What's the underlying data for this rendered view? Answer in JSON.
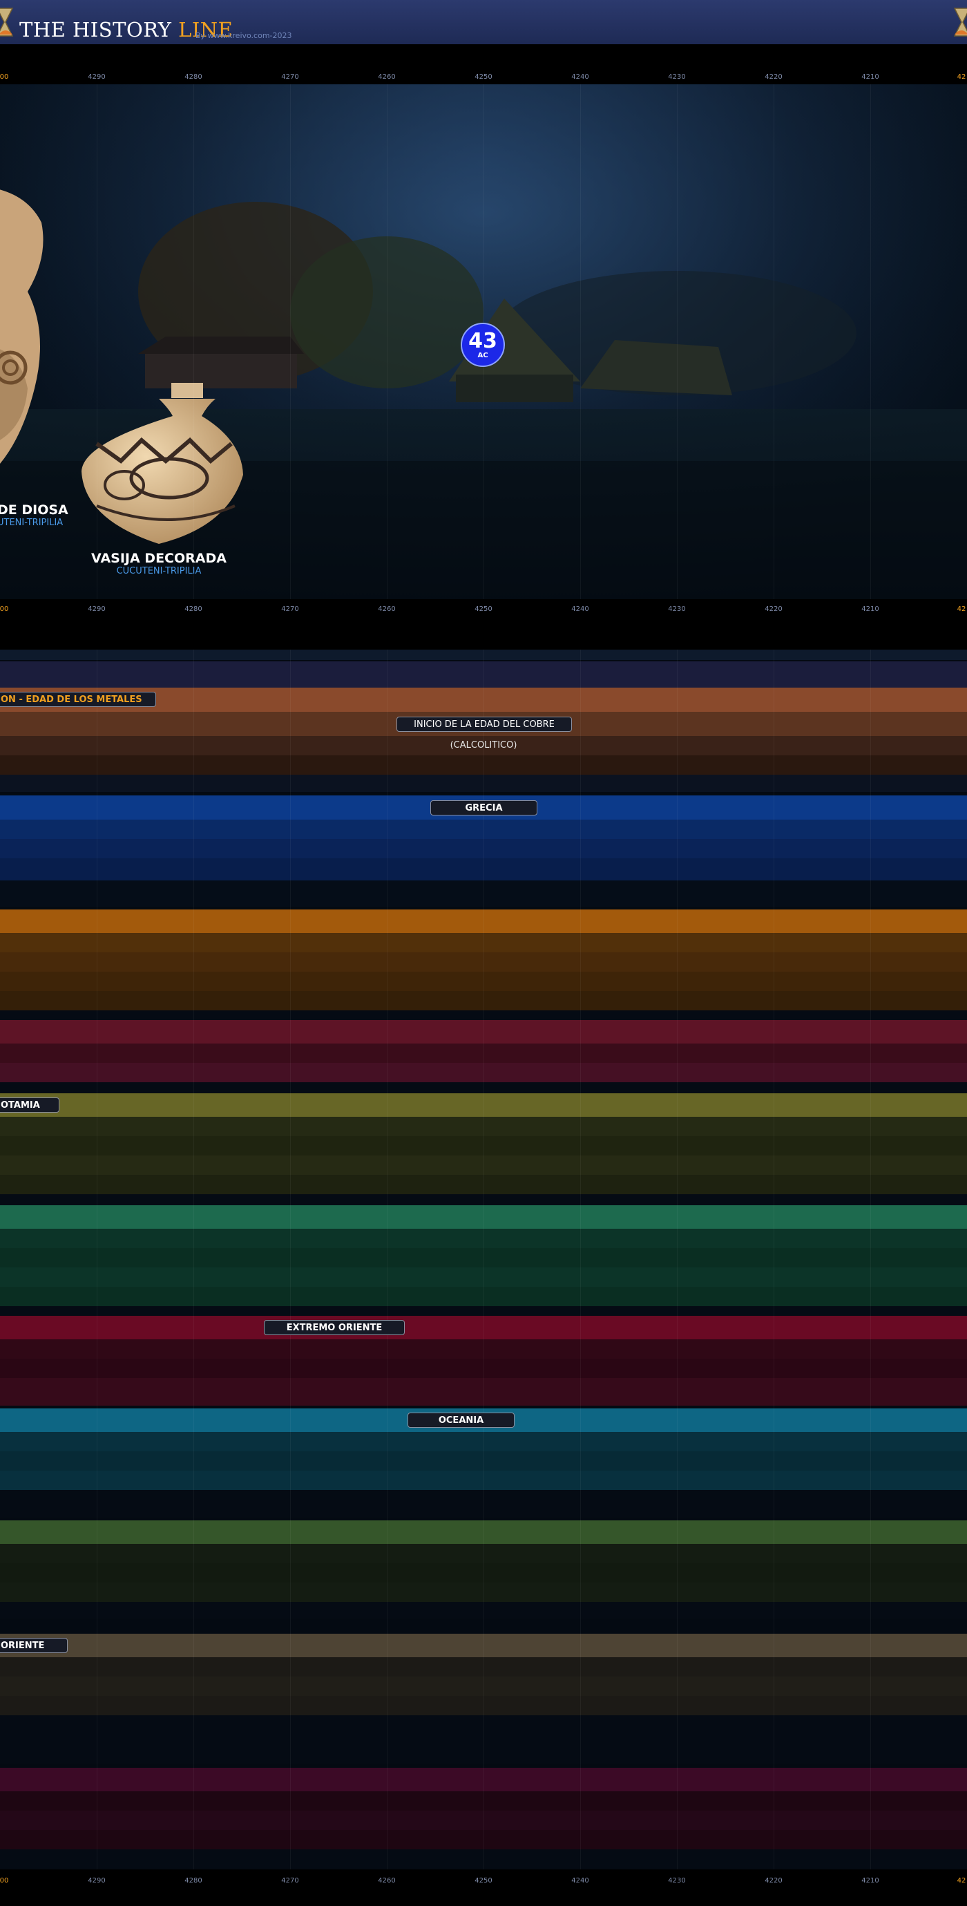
{
  "header": {
    "title_main": "THE HISTORY ",
    "title_accent": "LINE",
    "byline": "By www.kreivo.com-2023"
  },
  "ruler": {
    "edge_left": "00",
    "edge_right": "42",
    "ticks": [
      "4290",
      "4280",
      "4270",
      "4260",
      "4250",
      "4240",
      "4230",
      "4220",
      "4210"
    ]
  },
  "scene": {
    "year_badge": {
      "number": "43",
      "era": "AC"
    },
    "artifacts": [
      {
        "name": "DE DIOSA",
        "culture": "UTENI-TRIPILIA"
      },
      {
        "name": "VASIJA DECORADA",
        "culture": "CUCUTENI-TRIPILIA"
      }
    ]
  },
  "bands": {
    "prehistory_label": "ON  -  EDAD DE  LOS METALES",
    "copper_age_label": "INICIO DE LA EDAD DEL COBRE",
    "copper_age_sub": "(CALCOLITICO)",
    "greece_label": "GRECIA",
    "mesopotamia_label": "OTAMIA",
    "far_east_label": "EXTREMO ORIENTE",
    "oceania_label": "OCEANIA",
    "orient_label": "ORIENTE"
  },
  "colors": {
    "accent": "#f0a020",
    "prehistory": "#8a4a2c",
    "greece": "#0c3a8a",
    "orange": "#a35a0c",
    "crimson": "#5e1426",
    "olive": "#676626",
    "teal": "#1d6a4e",
    "far_east": "#6a0a24",
    "oceania": "#0e6684",
    "green": "#35562a",
    "brown": "#4e4434",
    "purple": "#3c0a26",
    "badge": "#1c28e8"
  }
}
